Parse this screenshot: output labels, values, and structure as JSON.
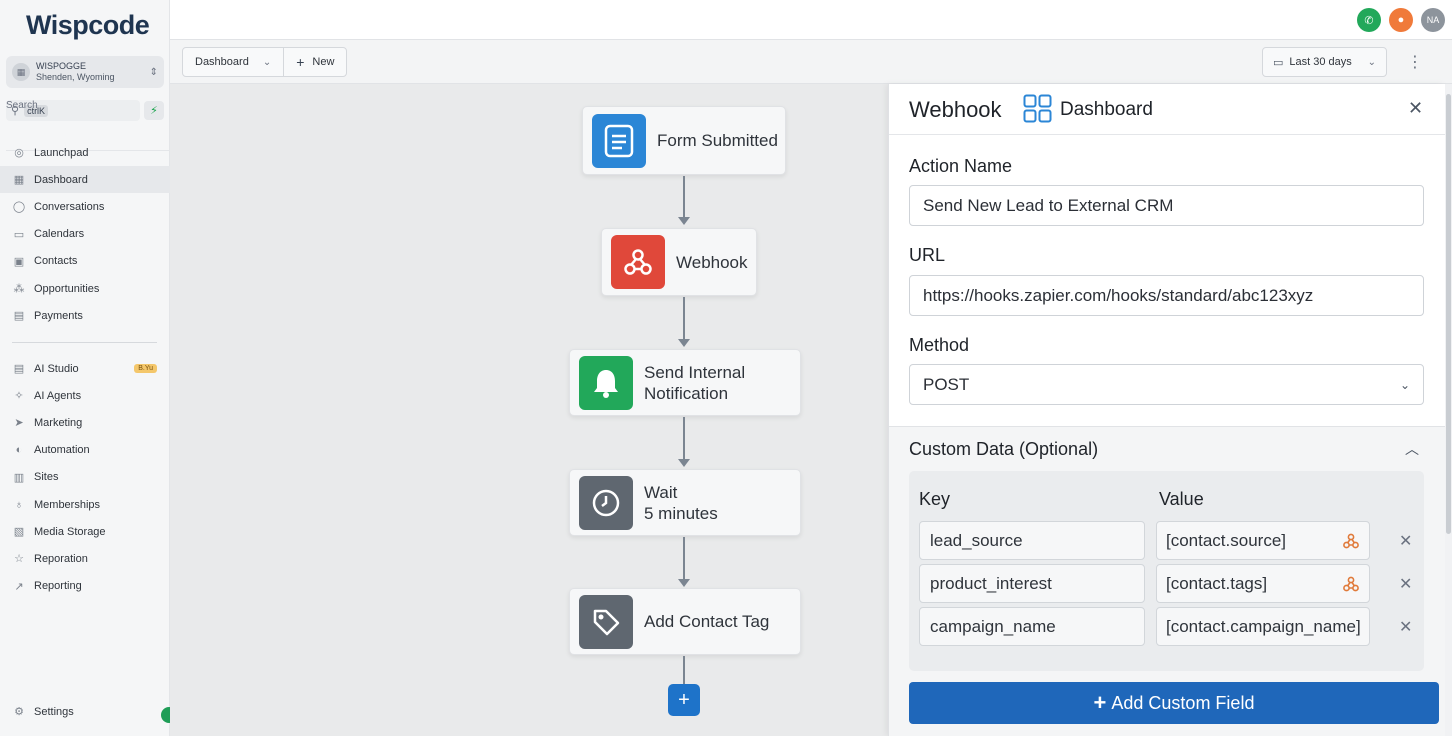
{
  "brand": {
    "logo_text": "Wispcode"
  },
  "account": {
    "name": "WISPOGGE",
    "location": "Shenden, Wyoming",
    "avatar_initials": "NA"
  },
  "search": {
    "placeholder": "Search",
    "shortcut": "ctrlK"
  },
  "nav_primary": [
    {
      "label": "Launchpad",
      "icon": "launchpad-icon"
    },
    {
      "label": "Dashboard",
      "icon": "dashboard-icon",
      "active": true
    },
    {
      "label": "Conversations",
      "icon": "chat-icon"
    },
    {
      "label": "Calendars",
      "icon": "calendar-icon"
    },
    {
      "label": "Contacts",
      "icon": "contacts-icon"
    },
    {
      "label": "Opportunities",
      "icon": "opportunities-icon"
    },
    {
      "label": "Payments",
      "icon": "payments-icon"
    }
  ],
  "nav_secondary": [
    {
      "label": "AI Studio",
      "icon": "ai-studio-icon",
      "badge": "B.Yu"
    },
    {
      "label": "AI Agents",
      "icon": "ai-agents-icon"
    },
    {
      "label": "Marketing",
      "icon": "marketing-icon"
    },
    {
      "label": "Automation",
      "icon": "automation-icon"
    },
    {
      "label": "Sites",
      "icon": "sites-icon"
    },
    {
      "label": "Memberships",
      "icon": "memberships-icon"
    },
    {
      "label": "Media Storage",
      "icon": "media-icon"
    },
    {
      "label": "Reporation",
      "icon": "star-icon"
    },
    {
      "label": "Reporting",
      "icon": "reporting-icon"
    }
  ],
  "settings_label": "Settings",
  "toolbar": {
    "view_label": "Dashboard",
    "new_label": "New",
    "date_range": "Last 30 days"
  },
  "workflow": {
    "nodes": [
      {
        "label": "Form Submitted",
        "icon": "form-icon",
        "color": "#2b86d6"
      },
      {
        "label": "Webhook",
        "icon": "webhook-icon",
        "color": "#e0483a"
      },
      {
        "label": "Send Internal Notification",
        "icon": "bell-icon",
        "color": "#22a85a"
      },
      {
        "label": "Wait",
        "sub": "5 minutes",
        "icon": "clock-icon",
        "color": "#5f6770"
      },
      {
        "label": "Add Contact Tag",
        "icon": "tag-icon",
        "color": "#5f6770"
      }
    ]
  },
  "panel": {
    "title": "Webhook",
    "breadcrumb": "Dashboard",
    "action_name_label": "Action Name",
    "action_name_value": "Send New Lead to External CRM",
    "url_label": "URL",
    "url_value": "https://hooks.zapier.com/hooks/standard/abc123xyz",
    "method_label": "Method",
    "method_value": "POST",
    "custom_data_title": "Custom Data (Optional)",
    "key_header": "Key",
    "value_header": "Value",
    "rows": [
      {
        "key": "lead_source",
        "value": "[contact.source]"
      },
      {
        "key": "product_interest",
        "value": "[contact.tags]"
      },
      {
        "key": "campaign_name",
        "value": "[contact.campaign_name]"
      }
    ],
    "add_button_label": "Add Custom Field"
  },
  "colors": {
    "primary": "#1f67ba",
    "phone": "#22a85a",
    "bell": "#f07a3a"
  }
}
